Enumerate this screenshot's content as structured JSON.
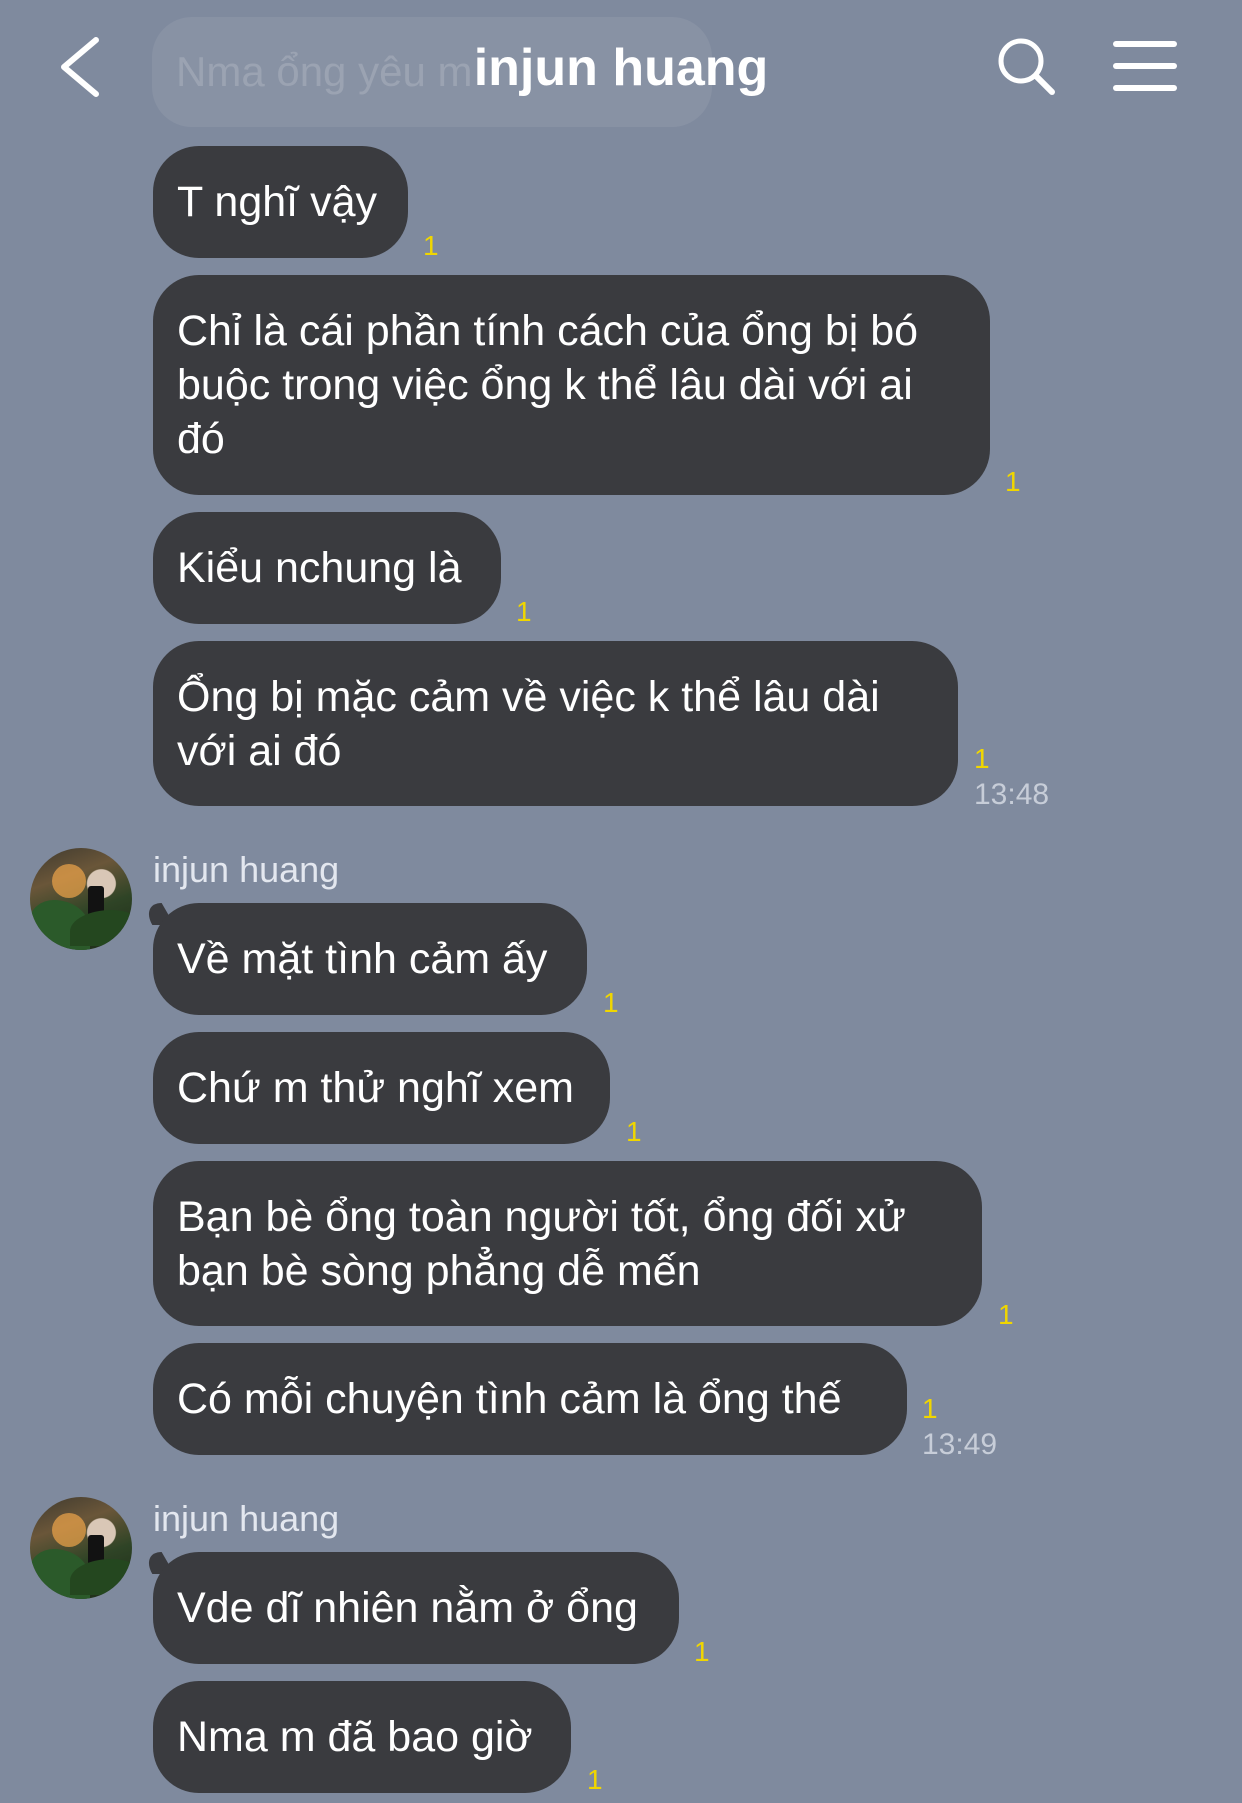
{
  "header": {
    "title": "injun huang",
    "ghost_preview": "Nma ổng yêu m",
    "back_icon": "chevron-left-icon",
    "search_icon": "search-icon",
    "menu_icon": "menu-icon"
  },
  "colors": {
    "background": "#7f8a9e",
    "bubble": "#3a3b3f",
    "read_indicator": "#f0d600"
  },
  "messages": [
    {
      "text": "T nghĩ vậy",
      "read": "1"
    },
    {
      "text": "Chỉ là cái phần tính cách của ổng bị bó buộc trong việc ổng k thể lâu dài với ai đó",
      "read": "1"
    },
    {
      "text": "Kiểu nchung là",
      "read": "1"
    },
    {
      "text": "Ổng bị mặc cảm về việc k thể lâu dài với ai đó",
      "read": "1",
      "time": "13:48"
    },
    {
      "sender": "injun huang",
      "text": "Về mặt tình cảm ấy",
      "read": "1"
    },
    {
      "text": "Chứ m thử nghĩ xem",
      "read": "1"
    },
    {
      "text": "Bạn bè ổng toàn người tốt, ổng đối xử bạn bè sòng phẳng dễ mến",
      "read": "1"
    },
    {
      "text": "Có mỗi chuyện tình cảm là ổng thế",
      "read": "1",
      "time": "13:49"
    },
    {
      "sender": "injun huang",
      "text": "Vde dĩ nhiên nằm ở ổng",
      "read": "1"
    },
    {
      "text": "Nma m đã bao giờ",
      "read": "1"
    }
  ]
}
